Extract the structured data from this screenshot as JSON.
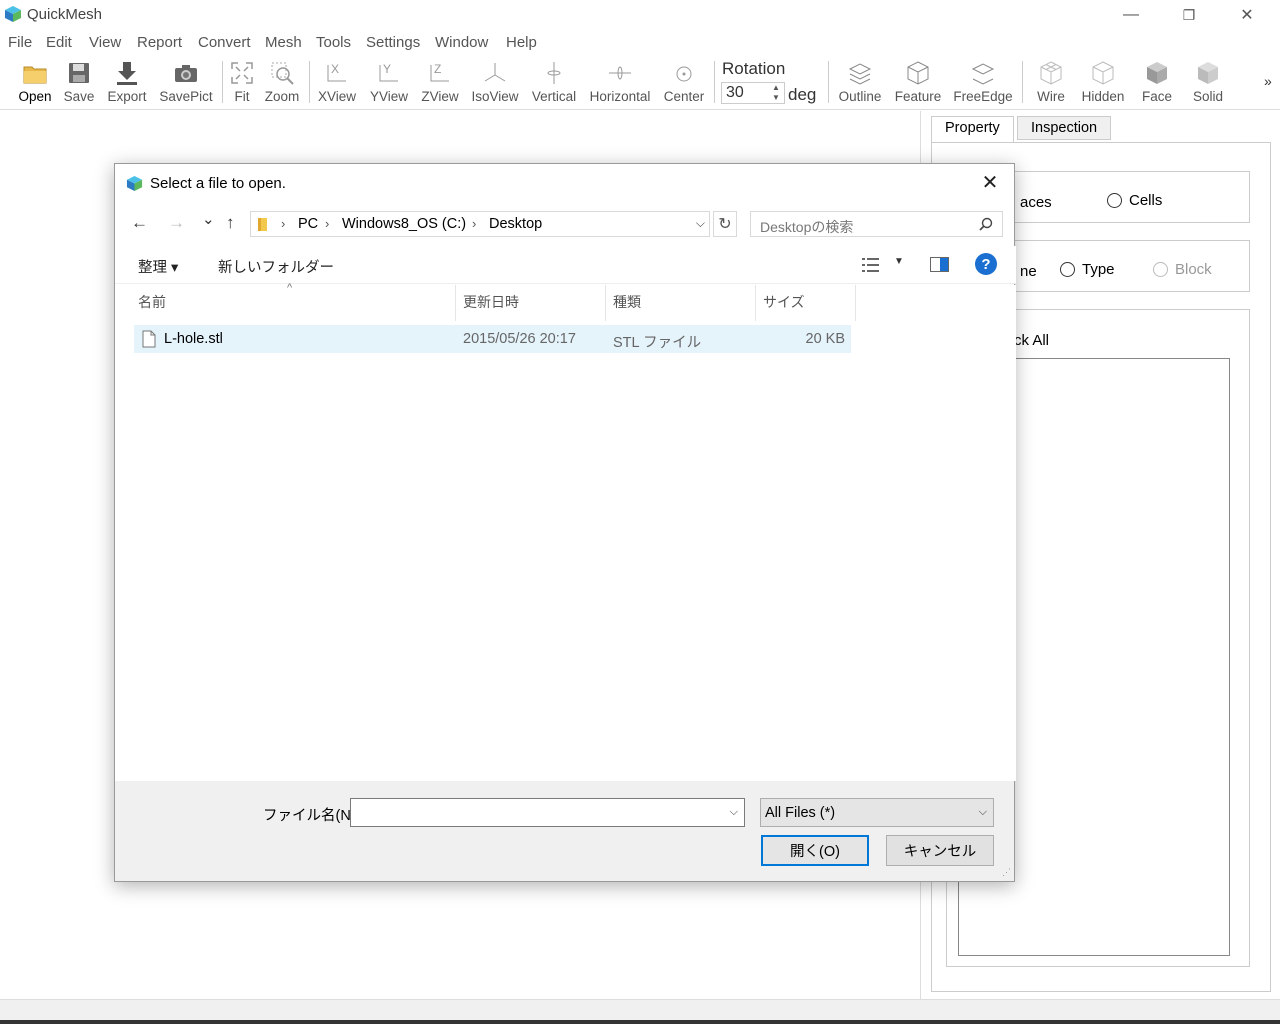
{
  "app": {
    "title": "QuickMesh"
  },
  "window_controls": {
    "minimize": "—",
    "restore": "❐",
    "close": "✕"
  },
  "menu": [
    "File",
    "Edit",
    "View",
    "Report",
    "Convert",
    "Mesh",
    "Tools",
    "Settings",
    "Window",
    "Help"
  ],
  "toolbar": {
    "buttons": [
      "Open",
      "Save",
      "Export",
      "SavePict",
      "Fit",
      "Zoom",
      "XView",
      "YView",
      "ZView",
      "IsoView",
      "Vertical",
      "Horizontal",
      "Center",
      "Outline",
      "Feature",
      "FreeEdge",
      "Wire",
      "Hidden",
      "Face",
      "Solid"
    ],
    "rotation_label": "Rotation",
    "rotation_value": "30",
    "rotation_unit": "deg",
    "overflow": "»"
  },
  "side_panel": {
    "tabs": [
      "Property",
      "Inspection"
    ],
    "group1": {
      "partial_label": "aces",
      "cells_label": "Cells"
    },
    "group2": {
      "partial_label": "ne",
      "type_label": "Type",
      "block_label": "Block"
    },
    "partial_check_all": "ck All"
  },
  "dialog": {
    "title": "Select a file to open.",
    "close": "✕",
    "nav": {
      "back": "←",
      "forward": "→",
      "recent": "⌄",
      "up": "↑"
    },
    "breadcrumb": [
      "PC",
      "Windows8_OS (C:)",
      "Desktop"
    ],
    "refresh": "↻",
    "search_placeholder": "Desktopの検索",
    "commands": {
      "organize": "整理 ▾",
      "new_folder": "新しいフォルダー"
    },
    "help": "?",
    "columns": [
      "名前",
      "更新日時",
      "種類",
      "サイズ"
    ],
    "files": [
      {
        "name": "L-hole.stl",
        "modified": "2015/05/26 20:17",
        "type": "STL ファイル",
        "size": "20 KB"
      }
    ],
    "filename_label": "ファイル名(N):",
    "filename_value": "",
    "filetype": "All Files (*)",
    "open_button": "開く(O)",
    "cancel_button": "キャンセル"
  },
  "colors": {
    "accent": "#0078d7",
    "selection": "#e5f3fb",
    "help": "#1a6fd0"
  }
}
